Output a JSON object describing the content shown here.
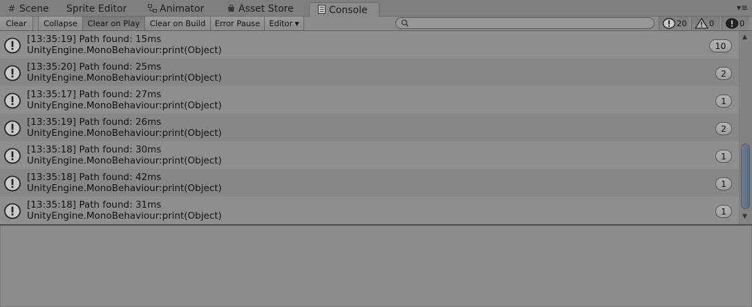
{
  "tabs": [
    {
      "label": "Scene",
      "icon": "grid-icon",
      "active": false
    },
    {
      "label": "Sprite Editor",
      "icon": "",
      "active": false
    },
    {
      "label": "Animator",
      "icon": "animator-icon",
      "active": false
    },
    {
      "label": "Asset Store",
      "icon": "store-icon",
      "active": false
    },
    {
      "label": "Console",
      "icon": "console-icon",
      "active": true
    }
  ],
  "toolbar": {
    "clear": "Clear",
    "collapse": "Collapse",
    "clear_on_play": "Clear on Play",
    "clear_on_build": "Clear on Build",
    "error_pause": "Error Pause",
    "editor": "Editor",
    "search_value": "",
    "log_count": "20",
    "warning_count": "0",
    "error_count": "0"
  },
  "logs": [
    {
      "message": "[13:35:19] Path found: 15ms",
      "stack": "UnityEngine.MonoBehaviour:print(Object)",
      "count": "10"
    },
    {
      "message": "[13:35:20] Path found: 25ms",
      "stack": "UnityEngine.MonoBehaviour:print(Object)",
      "count": "2"
    },
    {
      "message": "[13:35:17] Path found: 27ms",
      "stack": "UnityEngine.MonoBehaviour:print(Object)",
      "count": "1"
    },
    {
      "message": "[13:35:19] Path found: 26ms",
      "stack": "UnityEngine.MonoBehaviour:print(Object)",
      "count": "2"
    },
    {
      "message": "[13:35:18] Path found: 30ms",
      "stack": "UnityEngine.MonoBehaviour:print(Object)",
      "count": "1"
    },
    {
      "message": "[13:35:18] Path found: 42ms",
      "stack": "UnityEngine.MonoBehaviour:print(Object)",
      "count": "1"
    },
    {
      "message": "[13:35:18] Path found: 31ms",
      "stack": "UnityEngine.MonoBehaviour:print(Object)",
      "count": "1"
    }
  ],
  "colors": {
    "background": "#8a8a8a",
    "scroll_thumb": "#5d6d82"
  }
}
